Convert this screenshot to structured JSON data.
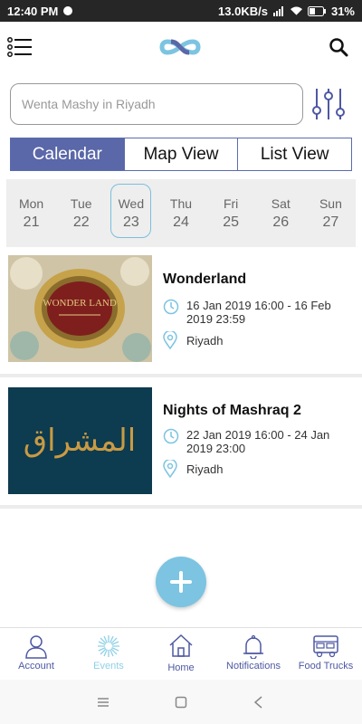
{
  "status_bar": {
    "time": "12:40 PM",
    "network_speed": "13.0KB/s",
    "battery": "31%"
  },
  "header": {
    "menu_icon": "list-menu-icon",
    "logo_icon": "infinity-logo",
    "search_icon": "search-icon"
  },
  "search": {
    "placeholder": "Wenta Mashy in Riyadh",
    "value": ""
  },
  "view_tabs": [
    {
      "label": "Calendar",
      "active": true
    },
    {
      "label": "Map View",
      "active": false
    },
    {
      "label": "List View",
      "active": false
    }
  ],
  "days": [
    {
      "name": "Mon",
      "num": "21"
    },
    {
      "name": "Tue",
      "num": "22"
    },
    {
      "name": "Wed",
      "num": "23",
      "selected": true
    },
    {
      "name": "Thu",
      "num": "24"
    },
    {
      "name": "Fri",
      "num": "25"
    },
    {
      "name": "Sat",
      "num": "26"
    },
    {
      "name": "Sun",
      "num": "27"
    }
  ],
  "events": [
    {
      "title": "Wonderland",
      "date": "16 Jan 2019 16:00 - 16 Feb 2019 23:59",
      "location": "Riyadh",
      "image_text": "WONDER LAND"
    },
    {
      "title": "Nights of Mashraq 2",
      "date": "22 Jan 2019 16:00 - 24 Jan 2019 23:00",
      "location": "Riyadh",
      "image_text": "المشراق"
    }
  ],
  "bottom_nav": [
    {
      "label": "Account",
      "icon": "person-icon"
    },
    {
      "label": "Events",
      "icon": "fireworks-icon"
    },
    {
      "label": "Home",
      "icon": "home-icon"
    },
    {
      "label": "Notifications",
      "icon": "bell-icon"
    },
    {
      "label": "Food Trucks",
      "icon": "food-truck-icon"
    }
  ],
  "colors": {
    "accent": "#5a67a8",
    "fab": "#7cc4e1",
    "highlight": "#8fd0e7"
  }
}
